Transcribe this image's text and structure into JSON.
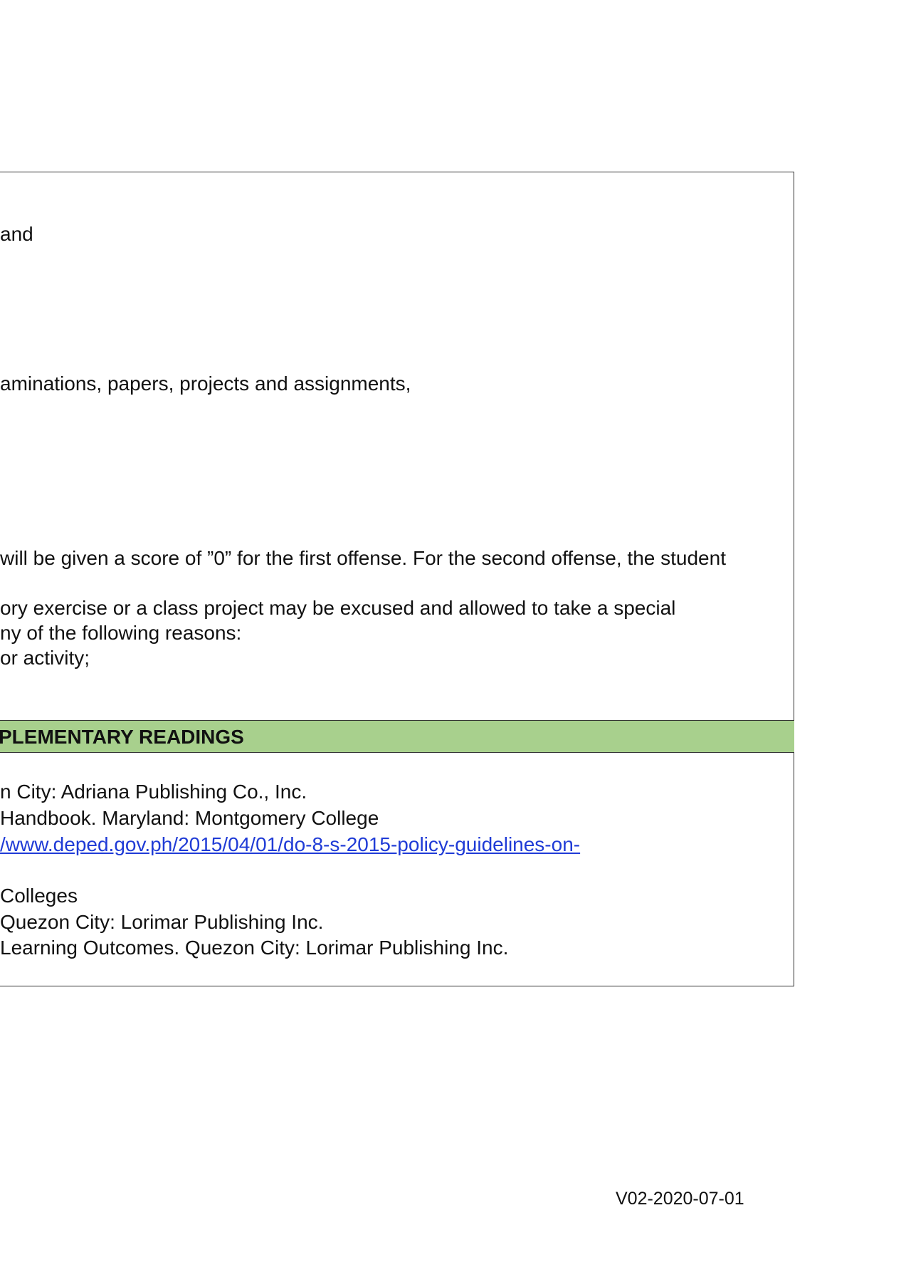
{
  "policies": {
    "line_1": "and",
    "line_2": "aminations, papers, projects and assignments,",
    "line_3": "will be given a score of ”0” for the first offense. For the second offense, the student",
    "line_4": "ory exercise or a class project may be excused and allowed to take a special",
    "line_5": "ny of the following reasons:",
    "line_6": "or activity;"
  },
  "readings": {
    "header": "PLEMENTARY READINGS",
    "items": [
      "n City: Adriana Publishing Co., Inc.",
      " Handbook. Maryland: Montgomery College",
      "/www.deped.gov.ph/2015/04/01/do-8-s-2015-policy-guidelines-on-",
      "Colleges",
      " Quezon City: Lorimar Publishing Inc.",
      "Learning Outcomes. Quezon City: Lorimar Publishing Inc."
    ]
  },
  "footer": {
    "version": "V02-2020-07-01"
  },
  "colors": {
    "section_bar": "#a8d08d",
    "link": "#1f3bd6"
  }
}
